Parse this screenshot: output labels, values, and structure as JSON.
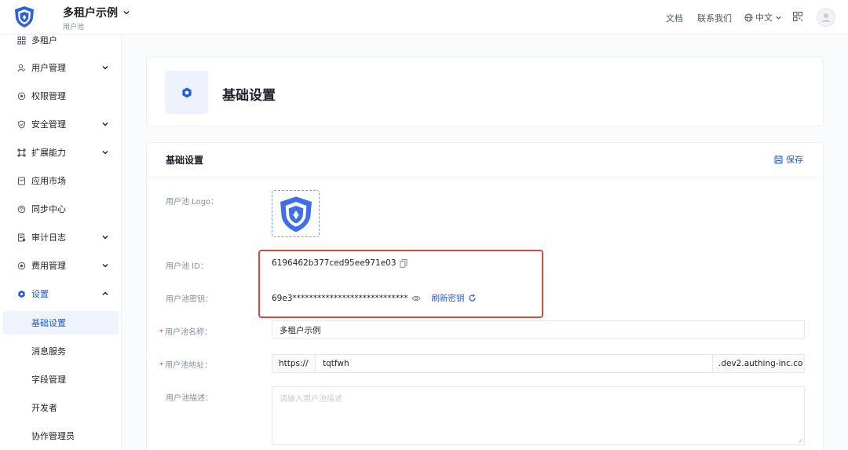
{
  "header": {
    "app_name": "多租户示例",
    "app_subtitle": "用户池",
    "docs": "文档",
    "contact": "联系我们",
    "language": "中文"
  },
  "sidebar": {
    "items": [
      {
        "label": "多租户"
      },
      {
        "label": "用户管理"
      },
      {
        "label": "权限管理"
      },
      {
        "label": "安全管理"
      },
      {
        "label": "扩展能力"
      },
      {
        "label": "应用市场"
      },
      {
        "label": "同步中心"
      },
      {
        "label": "审计日志"
      },
      {
        "label": "费用管理"
      },
      {
        "label": "设置"
      }
    ],
    "sub_items": [
      {
        "label": "基础设置"
      },
      {
        "label": "消息服务"
      },
      {
        "label": "字段管理"
      },
      {
        "label": "开发者"
      },
      {
        "label": "协作管理员"
      }
    ]
  },
  "page": {
    "title": "基础设置"
  },
  "section": {
    "title": "基础设置",
    "save_label": "保存"
  },
  "form": {
    "logo_label": "用户池 Logo：",
    "id_label": "用户池 ID：",
    "id_value": "6196462b377ced95ee971e03",
    "secret_label": "用户池密钥：",
    "secret_value": "69e3****************************",
    "refresh_label": "刷新密钥",
    "name_label": "用户池名称：",
    "name_value": "多租户示例",
    "address_label": "用户池地址：",
    "address_prefix": "https://",
    "address_value": "tqtfwh",
    "address_suffix": ".dev2.authing-inc.co",
    "desc_label": "用户池描述：",
    "desc_placeholder": "请输入用户池描述"
  },
  "colors": {
    "accent": "#215ae5",
    "logo_blue": "#3d6ef0",
    "highlight_border": "#d94a3d",
    "required": "#f53f3f"
  }
}
